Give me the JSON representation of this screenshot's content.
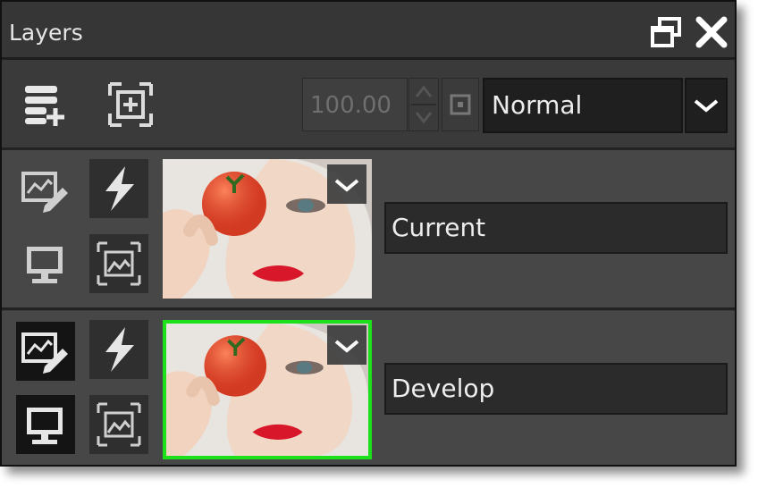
{
  "panel": {
    "title": "Layers",
    "icons": {
      "restore": "restore-window-icon",
      "close": "close-icon"
    }
  },
  "toolbar": {
    "add_layer_icon": "add-layer-icon",
    "fit_icon": "fit-frame-icon",
    "opacity_value": "100.00",
    "spin_icon": "spin-arrows-icon",
    "reset_icon": "square-dot-icon",
    "blend_mode": "Normal",
    "dropdown_icon": "chevron-down-icon"
  },
  "layers": [
    {
      "name": "Current",
      "selected": false,
      "edit_icon": "edit-image-icon",
      "effects_icon": "lightning-icon",
      "visible_icon": "monitor-icon",
      "mask_icon": "image-frame-icon"
    },
    {
      "name": "Develop",
      "selected": true,
      "edit_icon": "edit-image-icon",
      "effects_icon": "lightning-icon",
      "visible_icon": "monitor-icon",
      "mask_icon": "image-frame-icon"
    }
  ],
  "colors": {
    "selection": "#1ce01c",
    "panel_bg": "#3c3c3c"
  }
}
